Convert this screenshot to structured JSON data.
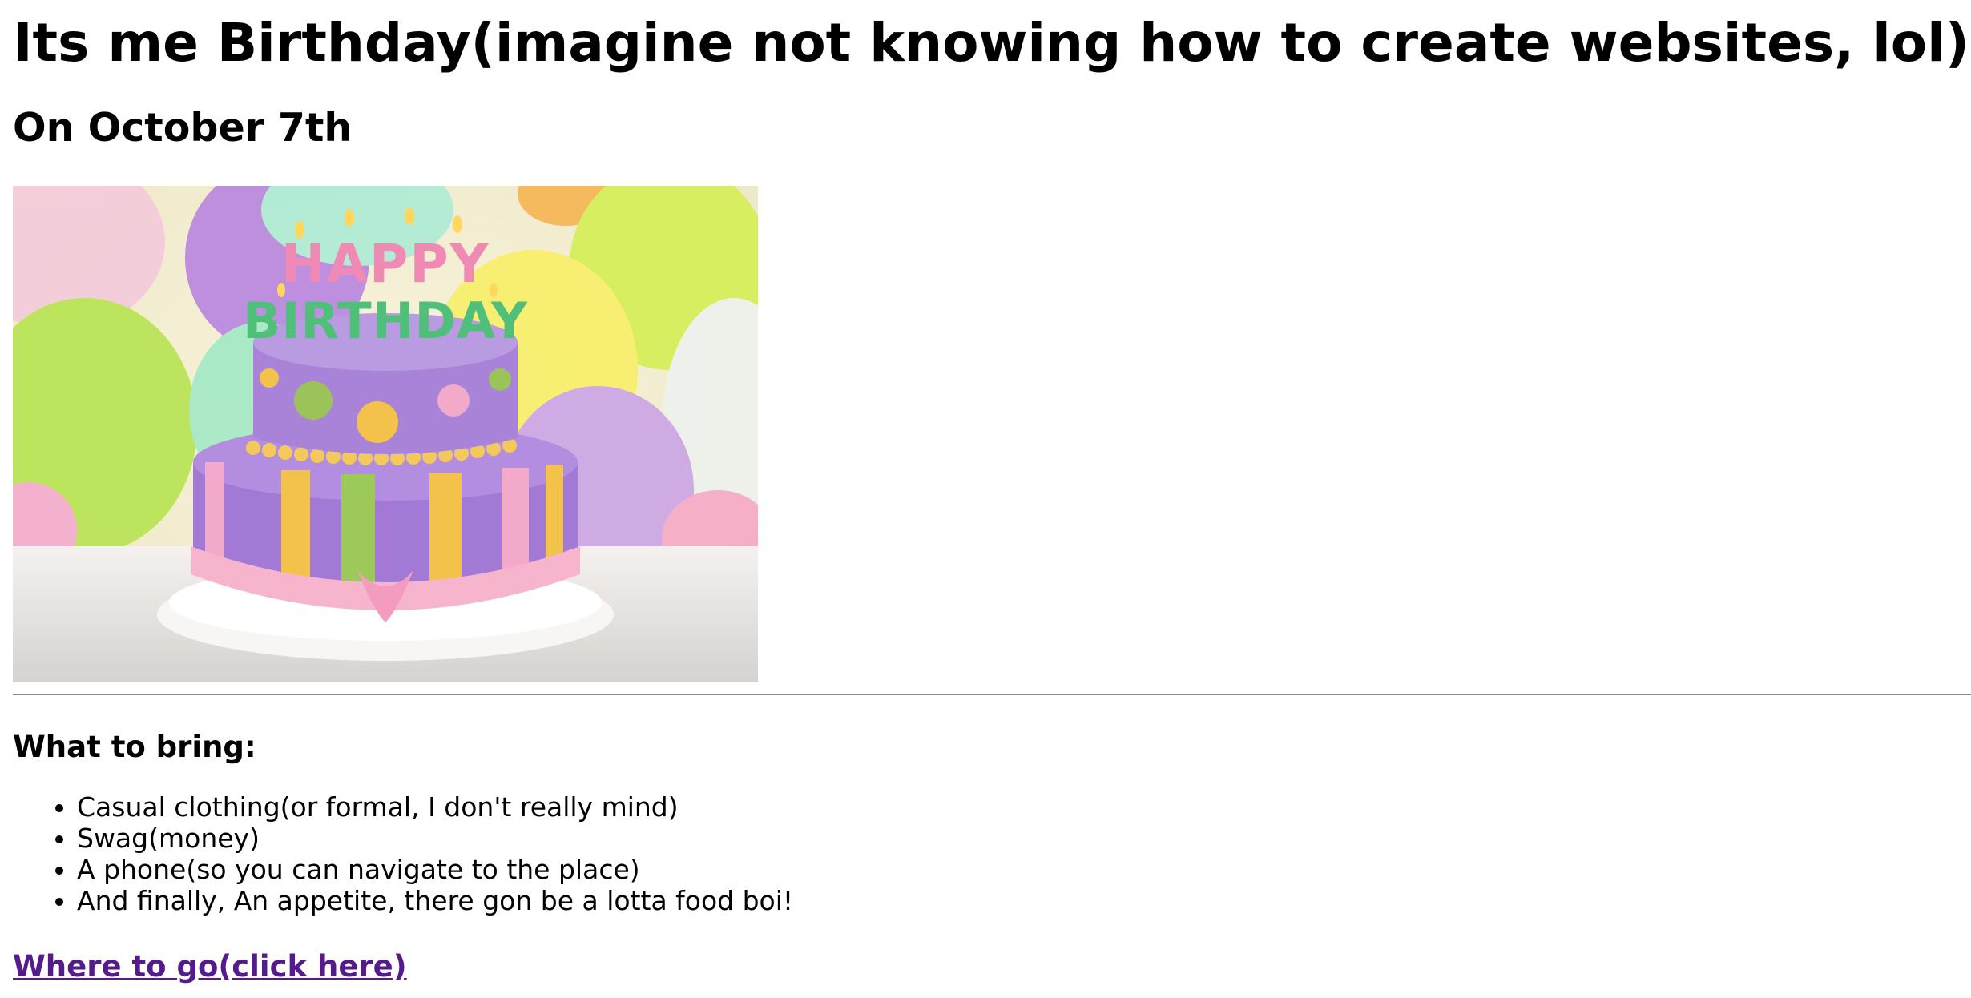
{
  "header": {
    "title": "Its me Birthday(imagine not knowing how to create websites, lol)",
    "subtitle": "On October 7th"
  },
  "image": {
    "cake_topper_top": "HAPPY",
    "cake_topper_bottom": "BIRTHDAY"
  },
  "bring": {
    "heading": "What to bring:",
    "items": [
      "Casual clothing(or formal, I don't really mind)",
      "Swag(money)",
      "A phone(so you can navigate to the place)",
      "And finally, An appetite, there gon be a lotta food boi!"
    ]
  },
  "link": {
    "label": "Where to go(click here)"
  },
  "colors": {
    "link_visited": "#551a8b",
    "divider": "#8c8c8c"
  }
}
